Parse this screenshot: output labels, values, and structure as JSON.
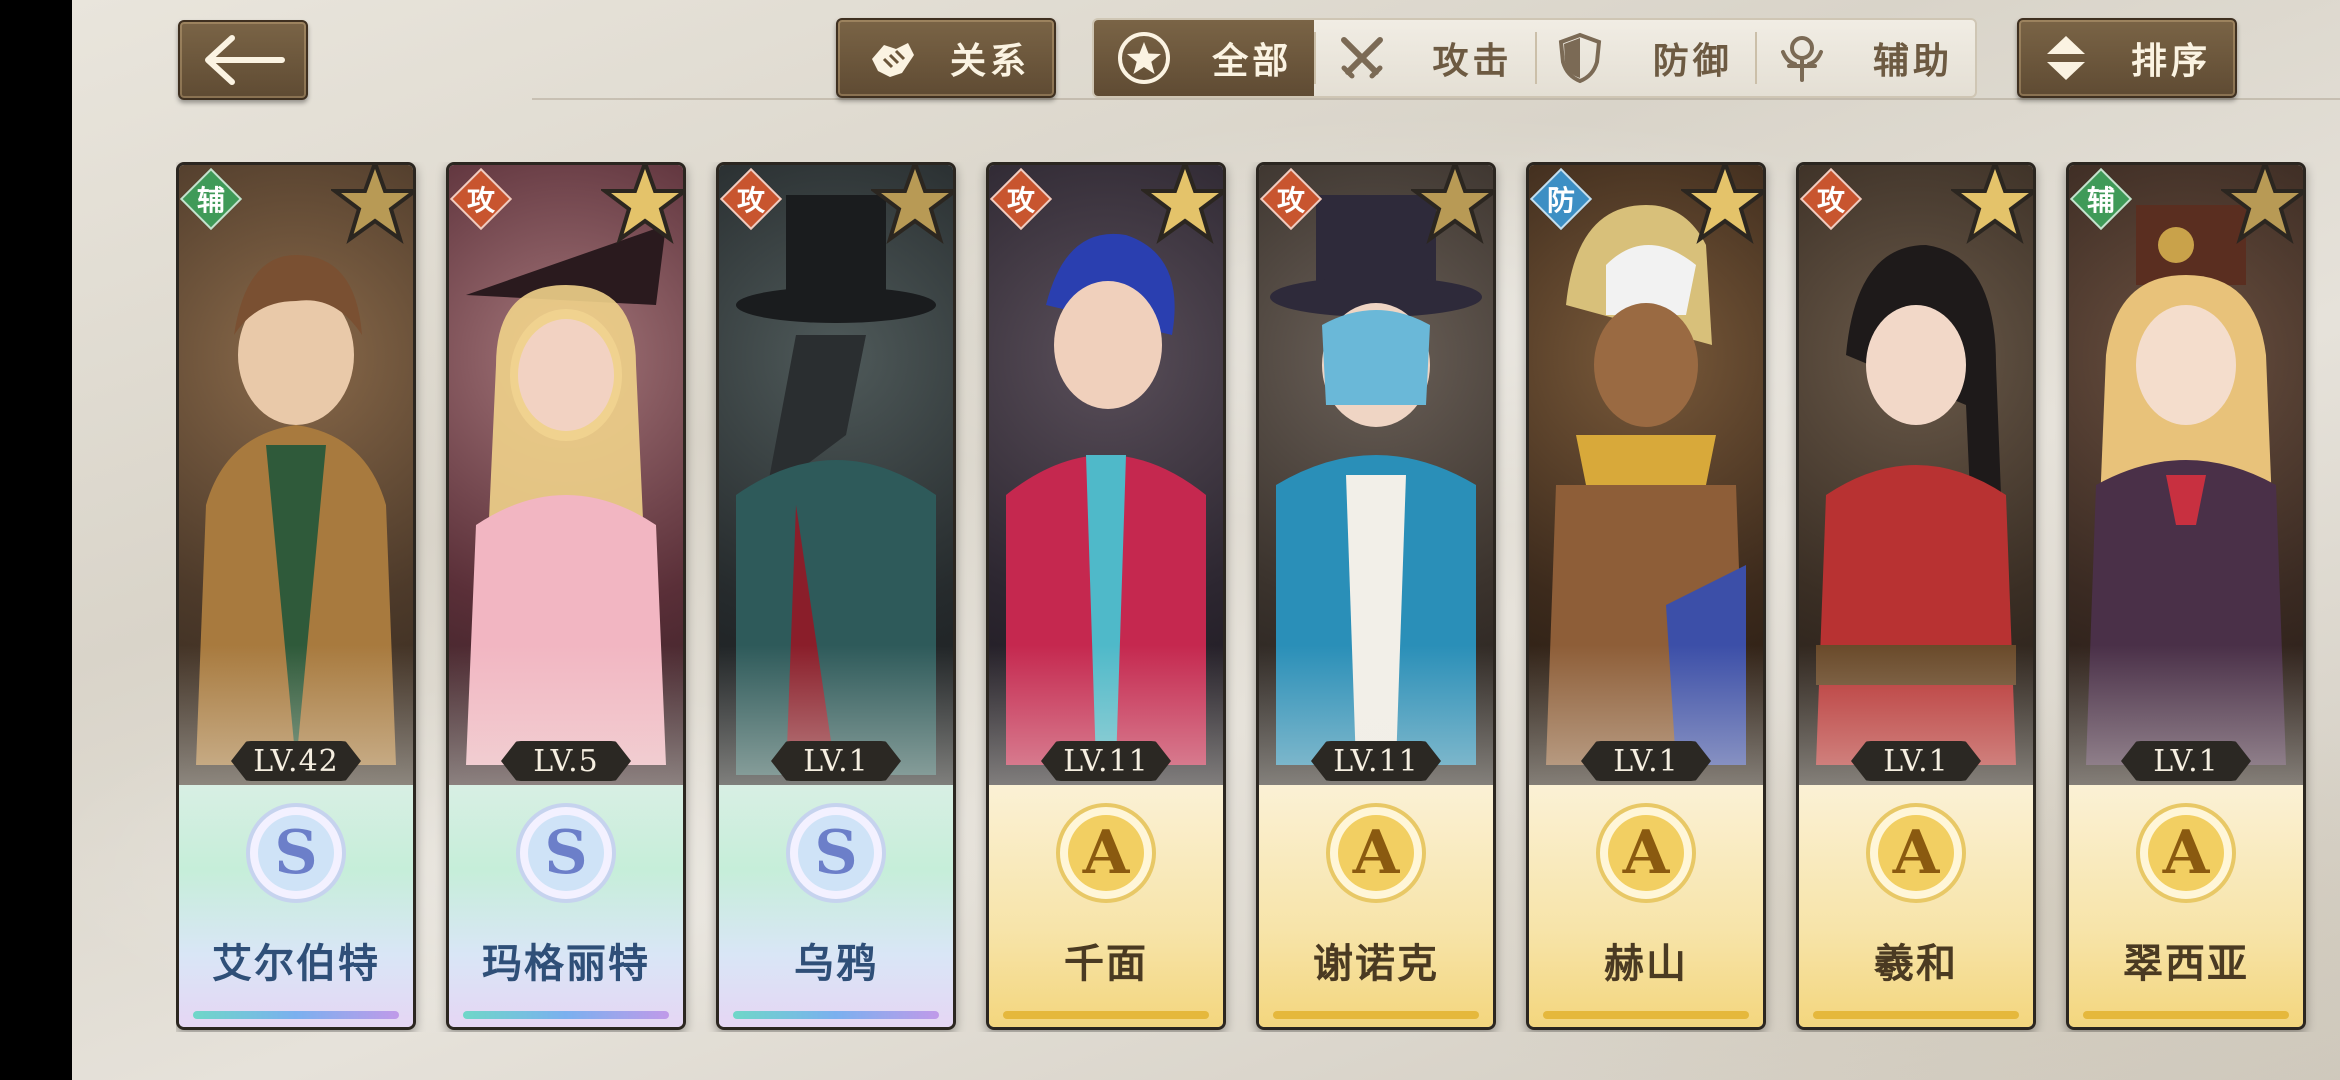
{
  "toolbar": {
    "relation_label": "关系",
    "sort_label": "排序",
    "filters": [
      {
        "label": "全部",
        "icon": "star-circle-icon",
        "active": true
      },
      {
        "label": "攻击",
        "icon": "crossed-swords-icon",
        "active": false
      },
      {
        "label": "防御",
        "icon": "shield-icon",
        "active": false
      },
      {
        "label": "辅助",
        "icon": "support-icon",
        "active": false
      }
    ]
  },
  "characters": [
    {
      "name": "艾尔伯特",
      "role": "辅",
      "level": "LV.42",
      "rank": "S"
    },
    {
      "name": "玛格丽特",
      "role": "攻",
      "level": "LV.5",
      "rank": "S"
    },
    {
      "name": "乌鸦",
      "role": "攻",
      "level": "LV.1",
      "rank": "S"
    },
    {
      "name": "千面",
      "role": "攻",
      "level": "LV.11",
      "rank": "A"
    },
    {
      "name": "谢诺克",
      "role": "攻",
      "level": "LV.11",
      "rank": "A"
    },
    {
      "name": "赫山",
      "role": "防",
      "level": "LV.1",
      "rank": "A"
    },
    {
      "name": "羲和",
      "role": "攻",
      "level": "LV.1",
      "rank": "A"
    },
    {
      "name": "翠西亚",
      "role": "辅",
      "level": "LV.1",
      "rank": "A"
    }
  ],
  "colors": {
    "role_support": "#3f9a58",
    "role_attack": "#c8552f",
    "role_defense": "#3d8fc4",
    "button_brown": "#6b5539",
    "gold": "#e5b83c"
  }
}
